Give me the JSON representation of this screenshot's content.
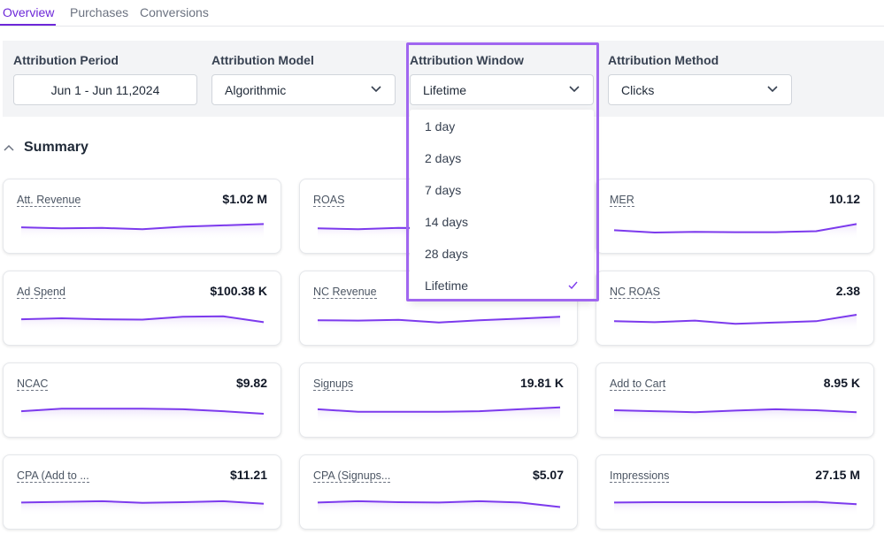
{
  "tabs": [
    {
      "label": "Overview",
      "active": true
    },
    {
      "label": "Purchases",
      "active": false
    },
    {
      "label": "Conversions",
      "active": false
    }
  ],
  "filters": {
    "period": {
      "label": "Attribution Period",
      "value": "Jun 1 - Jun 11,2024"
    },
    "model": {
      "label": "Attribution Model",
      "value": "Algorithmic"
    },
    "window": {
      "label": "Attribution Window",
      "value": "Lifetime"
    },
    "method": {
      "label": "Attribution Method",
      "value": "Clicks"
    }
  },
  "window_options": [
    "1 day",
    "2 days",
    "7 days",
    "14 days",
    "28 days",
    "Lifetime"
  ],
  "window_selected": "Lifetime",
  "summary": {
    "title": "Summary"
  },
  "cards": [
    {
      "title": "Att. Revenue",
      "value": "$1.02 M",
      "trend": [
        0.45,
        0.4,
        0.42,
        0.35,
        0.48,
        0.55,
        0.62
      ]
    },
    {
      "title": "ROAS",
      "value": "",
      "trend": [
        0.4,
        0.35,
        0.42,
        0.4,
        0.42,
        0.45,
        0.5
      ]
    },
    {
      "title": "MER",
      "value": "10.12",
      "trend": [
        0.3,
        0.18,
        0.22,
        0.2,
        0.2,
        0.25,
        0.62
      ]
    },
    {
      "title": "Ad Spend",
      "value": "$100.38 K",
      "trend": [
        0.45,
        0.5,
        0.45,
        0.43,
        0.58,
        0.6,
        0.3
      ]
    },
    {
      "title": "NC Revenue",
      "value": "",
      "trend": [
        0.4,
        0.38,
        0.42,
        0.28,
        0.4,
        0.48,
        0.58
      ]
    },
    {
      "title": "NC ROAS",
      "value": "2.38",
      "trend": [
        0.35,
        0.3,
        0.38,
        0.22,
        0.28,
        0.35,
        0.68
      ]
    },
    {
      "title": "NCAC",
      "value": "$9.82",
      "trend": [
        0.45,
        0.58,
        0.58,
        0.58,
        0.55,
        0.45,
        0.32
      ]
    },
    {
      "title": "Signups",
      "value": "19.81 K",
      "trend": [
        0.55,
        0.42,
        0.42,
        0.42,
        0.45,
        0.55,
        0.65
      ]
    },
    {
      "title": "Add to Cart",
      "value": "8.95 K",
      "trend": [
        0.5,
        0.45,
        0.4,
        0.48,
        0.55,
        0.5,
        0.4
      ]
    },
    {
      "title": "CPA (Add to ...",
      "value": "$11.21",
      "trend": [
        0.48,
        0.52,
        0.55,
        0.47,
        0.5,
        0.55,
        0.42
      ]
    },
    {
      "title": "CPA (Signups...",
      "value": "$5.07",
      "trend": [
        0.48,
        0.55,
        0.5,
        0.48,
        0.55,
        0.48,
        0.25
      ]
    },
    {
      "title": "Impressions",
      "value": "27.15 M",
      "trend": [
        0.48,
        0.5,
        0.5,
        0.5,
        0.5,
        0.52,
        0.4
      ]
    }
  ],
  "colors": {
    "accent": "#6d28d9",
    "line": "#7c3aed",
    "highlight": "#a066f0"
  },
  "icons": {
    "dropdown": "chevron-down-icon",
    "collapse": "chevron-up-icon",
    "selected": "check-icon"
  }
}
